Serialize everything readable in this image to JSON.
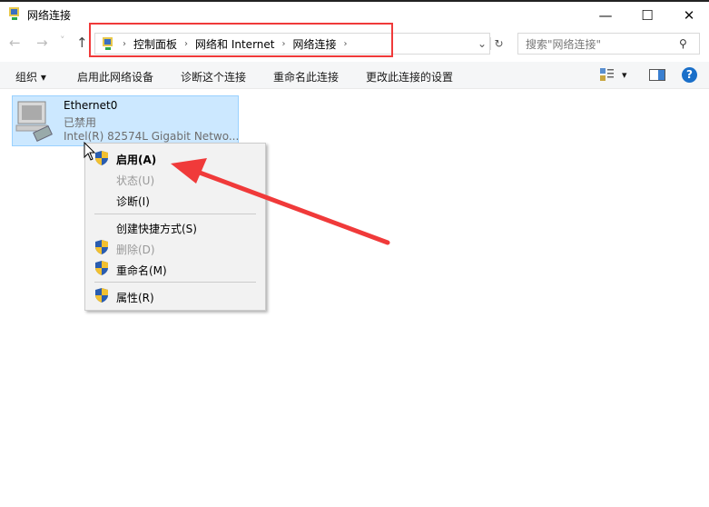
{
  "window": {
    "title": "网络连接",
    "minimize": "—",
    "maximize": "☐",
    "close": "✕"
  },
  "nav": {
    "back": "←",
    "forward": "→",
    "recent": "˅",
    "up": "↑"
  },
  "address": {
    "crumbs": [
      "控制面板",
      "网络和 Internet",
      "网络连接"
    ],
    "dropdown": "⌄",
    "refresh": "↻"
  },
  "search": {
    "placeholder": "搜索\"网络连接\"",
    "icon": "⚲"
  },
  "toolbar": {
    "organize": "组织 ▾",
    "enable": "启用此网络设备",
    "diagnose": "诊断这个连接",
    "rename": "重命名此连接",
    "change": "更改此连接的设置",
    "view": "▾",
    "help": "?"
  },
  "adapter": {
    "name": "Ethernet0",
    "status": "已禁用",
    "device": "Intel(R) 82574L Gigabit Netwo..."
  },
  "context_menu": {
    "items": [
      {
        "label": "启用(A)",
        "shield": true,
        "disabled": false,
        "bold": true
      },
      {
        "label": "状态(U)",
        "shield": false,
        "disabled": true
      },
      {
        "label": "诊断(I)",
        "shield": false,
        "disabled": false
      },
      {
        "label": "创建快捷方式(S)",
        "shield": false,
        "disabled": false
      },
      {
        "label": "删除(D)",
        "shield": true,
        "disabled": true
      },
      {
        "label": "重命名(M)",
        "shield": true,
        "disabled": false
      },
      {
        "label": "属性(R)",
        "shield": true,
        "disabled": false
      }
    ]
  },
  "colors": {
    "annotation": "#f03a3a",
    "selection": "#cce8ff",
    "help": "#1a6fc9"
  }
}
